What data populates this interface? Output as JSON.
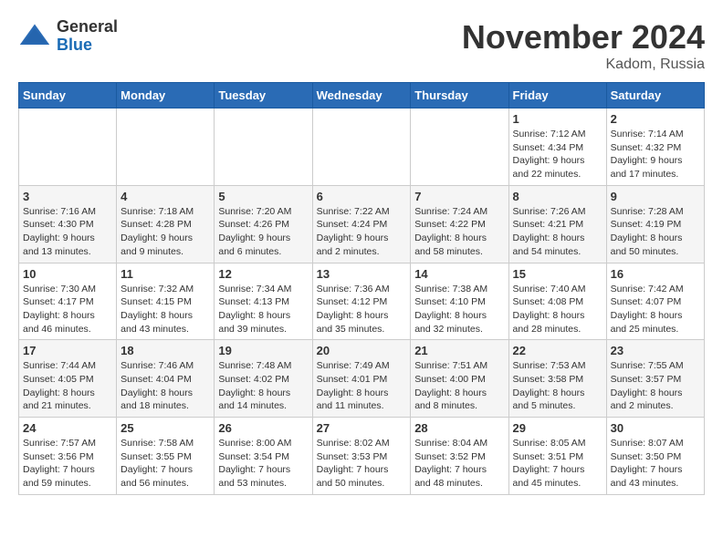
{
  "header": {
    "logo_line1": "General",
    "logo_line2": "Blue",
    "month_title": "November 2024",
    "location": "Kadom, Russia"
  },
  "weekdays": [
    "Sunday",
    "Monday",
    "Tuesday",
    "Wednesday",
    "Thursday",
    "Friday",
    "Saturday"
  ],
  "weeks": [
    [
      {
        "day": "",
        "info": ""
      },
      {
        "day": "",
        "info": ""
      },
      {
        "day": "",
        "info": ""
      },
      {
        "day": "",
        "info": ""
      },
      {
        "day": "",
        "info": ""
      },
      {
        "day": "1",
        "info": "Sunrise: 7:12 AM\nSunset: 4:34 PM\nDaylight: 9 hours\nand 22 minutes."
      },
      {
        "day": "2",
        "info": "Sunrise: 7:14 AM\nSunset: 4:32 PM\nDaylight: 9 hours\nand 17 minutes."
      }
    ],
    [
      {
        "day": "3",
        "info": "Sunrise: 7:16 AM\nSunset: 4:30 PM\nDaylight: 9 hours\nand 13 minutes."
      },
      {
        "day": "4",
        "info": "Sunrise: 7:18 AM\nSunset: 4:28 PM\nDaylight: 9 hours\nand 9 minutes."
      },
      {
        "day": "5",
        "info": "Sunrise: 7:20 AM\nSunset: 4:26 PM\nDaylight: 9 hours\nand 6 minutes."
      },
      {
        "day": "6",
        "info": "Sunrise: 7:22 AM\nSunset: 4:24 PM\nDaylight: 9 hours\nand 2 minutes."
      },
      {
        "day": "7",
        "info": "Sunrise: 7:24 AM\nSunset: 4:22 PM\nDaylight: 8 hours\nand 58 minutes."
      },
      {
        "day": "8",
        "info": "Sunrise: 7:26 AM\nSunset: 4:21 PM\nDaylight: 8 hours\nand 54 minutes."
      },
      {
        "day": "9",
        "info": "Sunrise: 7:28 AM\nSunset: 4:19 PM\nDaylight: 8 hours\nand 50 minutes."
      }
    ],
    [
      {
        "day": "10",
        "info": "Sunrise: 7:30 AM\nSunset: 4:17 PM\nDaylight: 8 hours\nand 46 minutes."
      },
      {
        "day": "11",
        "info": "Sunrise: 7:32 AM\nSunset: 4:15 PM\nDaylight: 8 hours\nand 43 minutes."
      },
      {
        "day": "12",
        "info": "Sunrise: 7:34 AM\nSunset: 4:13 PM\nDaylight: 8 hours\nand 39 minutes."
      },
      {
        "day": "13",
        "info": "Sunrise: 7:36 AM\nSunset: 4:12 PM\nDaylight: 8 hours\nand 35 minutes."
      },
      {
        "day": "14",
        "info": "Sunrise: 7:38 AM\nSunset: 4:10 PM\nDaylight: 8 hours\nand 32 minutes."
      },
      {
        "day": "15",
        "info": "Sunrise: 7:40 AM\nSunset: 4:08 PM\nDaylight: 8 hours\nand 28 minutes."
      },
      {
        "day": "16",
        "info": "Sunrise: 7:42 AM\nSunset: 4:07 PM\nDaylight: 8 hours\nand 25 minutes."
      }
    ],
    [
      {
        "day": "17",
        "info": "Sunrise: 7:44 AM\nSunset: 4:05 PM\nDaylight: 8 hours\nand 21 minutes."
      },
      {
        "day": "18",
        "info": "Sunrise: 7:46 AM\nSunset: 4:04 PM\nDaylight: 8 hours\nand 18 minutes."
      },
      {
        "day": "19",
        "info": "Sunrise: 7:48 AM\nSunset: 4:02 PM\nDaylight: 8 hours\nand 14 minutes."
      },
      {
        "day": "20",
        "info": "Sunrise: 7:49 AM\nSunset: 4:01 PM\nDaylight: 8 hours\nand 11 minutes."
      },
      {
        "day": "21",
        "info": "Sunrise: 7:51 AM\nSunset: 4:00 PM\nDaylight: 8 hours\nand 8 minutes."
      },
      {
        "day": "22",
        "info": "Sunrise: 7:53 AM\nSunset: 3:58 PM\nDaylight: 8 hours\nand 5 minutes."
      },
      {
        "day": "23",
        "info": "Sunrise: 7:55 AM\nSunset: 3:57 PM\nDaylight: 8 hours\nand 2 minutes."
      }
    ],
    [
      {
        "day": "24",
        "info": "Sunrise: 7:57 AM\nSunset: 3:56 PM\nDaylight: 7 hours\nand 59 minutes."
      },
      {
        "day": "25",
        "info": "Sunrise: 7:58 AM\nSunset: 3:55 PM\nDaylight: 7 hours\nand 56 minutes."
      },
      {
        "day": "26",
        "info": "Sunrise: 8:00 AM\nSunset: 3:54 PM\nDaylight: 7 hours\nand 53 minutes."
      },
      {
        "day": "27",
        "info": "Sunrise: 8:02 AM\nSunset: 3:53 PM\nDaylight: 7 hours\nand 50 minutes."
      },
      {
        "day": "28",
        "info": "Sunrise: 8:04 AM\nSunset: 3:52 PM\nDaylight: 7 hours\nand 48 minutes."
      },
      {
        "day": "29",
        "info": "Sunrise: 8:05 AM\nSunset: 3:51 PM\nDaylight: 7 hours\nand 45 minutes."
      },
      {
        "day": "30",
        "info": "Sunrise: 8:07 AM\nSunset: 3:50 PM\nDaylight: 7 hours\nand 43 minutes."
      }
    ]
  ]
}
